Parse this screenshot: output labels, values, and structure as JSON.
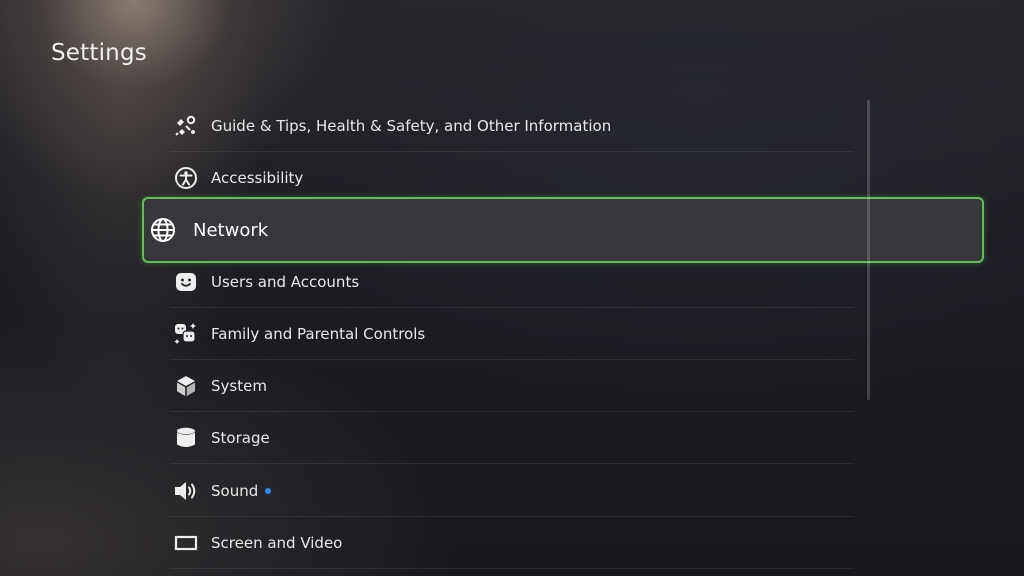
{
  "page": {
    "title": "Settings"
  },
  "menu": {
    "items": [
      {
        "label": "Guide & Tips, Health & Safety, and Other Information",
        "icon": "guide-icon"
      },
      {
        "label": "Accessibility",
        "icon": "accessibility-icon"
      },
      {
        "label": "Network",
        "icon": "globe-icon",
        "selected": true
      },
      {
        "label": "Users and Accounts",
        "icon": "user-face-icon"
      },
      {
        "label": "Family and Parental Controls",
        "icon": "family-icon"
      },
      {
        "label": "System",
        "icon": "cube-icon"
      },
      {
        "label": "Storage",
        "icon": "storage-icon"
      },
      {
        "label": "Sound",
        "icon": "speaker-icon",
        "badge": "new-dot"
      },
      {
        "label": "Screen and Video",
        "icon": "screen-icon"
      }
    ]
  },
  "colors": {
    "selection_border": "#5cc352",
    "notification_dot": "#2f8cf5"
  }
}
